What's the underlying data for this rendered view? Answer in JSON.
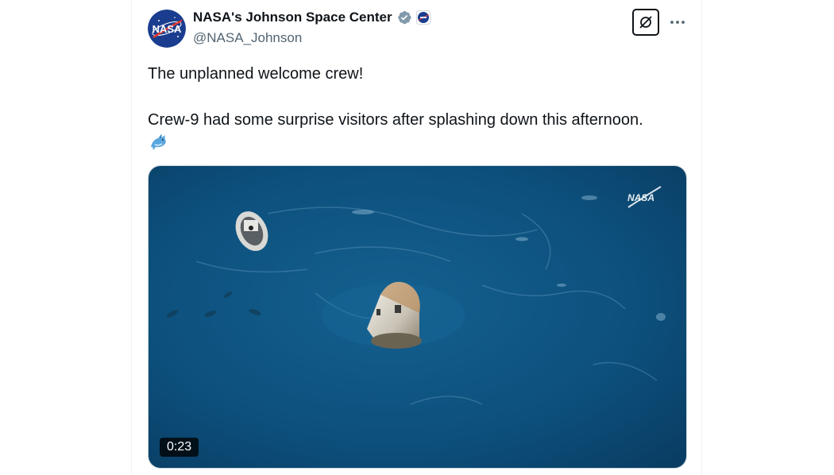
{
  "author": {
    "display_name": "NASA's Johnson Space Center",
    "handle": "@NASA_Johnson",
    "avatar_text": "NASA",
    "verified_badge_icon": "verified-badge-icon",
    "affiliation_icon": "nasa-affiliate-icon"
  },
  "actions": {
    "grok_icon": "grok-icon",
    "more_icon": "more-horizontal-icon"
  },
  "tweet": {
    "line1": "The unplanned welcome crew!",
    "line2": "Crew-9 had some surprise visitors after splashing down this afternoon.",
    "emoji_icon": "dolphin-emoji"
  },
  "media": {
    "type": "video",
    "watermark": "NASA",
    "duration": "0:23"
  },
  "colors": {
    "verified": "#829aab",
    "ocean": "#0c4f7a",
    "nasa_blue": "#1a3d8f",
    "nasa_red": "#e03c31"
  }
}
